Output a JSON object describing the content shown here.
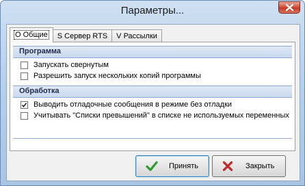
{
  "window": {
    "title": "Параметры...",
    "close_icon": "close-icon"
  },
  "tabs": [
    {
      "label": "О Общие",
      "active": true
    },
    {
      "label": "S Сервер RTS",
      "active": false
    },
    {
      "label": "V Рассылки",
      "active": false
    }
  ],
  "sections": {
    "program": {
      "title": "Программа",
      "options": [
        {
          "label": "Запускать свернутым",
          "checked": false
        },
        {
          "label": "Разрешить запуск нескольких копий программы",
          "checked": false
        }
      ]
    },
    "processing": {
      "title": "Обработка",
      "options": [
        {
          "label": "Выводить отладочные сообщения в режиме без отладки",
          "checked": true
        },
        {
          "label": "Учитывать \"Списки превышений\" в списке не используемых переменных",
          "checked": false
        }
      ]
    }
  },
  "buttons": {
    "accept_label": "Принять",
    "close_label": "Закрыть"
  },
  "colors": {
    "accept_icon": "#2e9a2e",
    "close_icon": "#c0282a",
    "section_header": "#c9d9ee"
  }
}
